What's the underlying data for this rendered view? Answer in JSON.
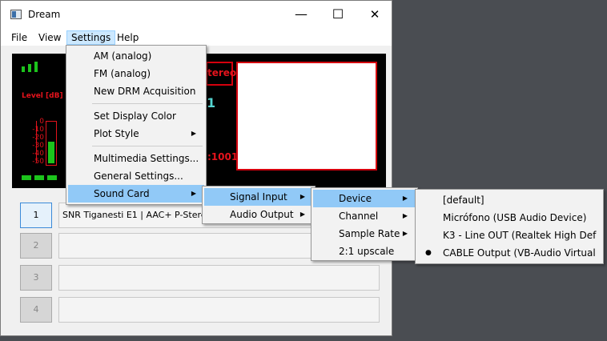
{
  "window": {
    "title": "Dream",
    "minimize": "—",
    "maximize": "☐",
    "close": "✕"
  },
  "menubar": {
    "file": "File",
    "view": "View",
    "settings": "Settings",
    "help": "Help"
  },
  "display": {
    "level_label": "Level [dB]",
    "scale": [
      "0",
      "-10",
      "-20",
      "-30",
      "-40",
      "-50"
    ],
    "stereo_text": "tereo",
    "digit": "1",
    "code_text": ":1001",
    "meter_level": 0.55
  },
  "channels": [
    {
      "number": "1",
      "label": "SNR Tiganesti E1   |   AAC+ P-Stereo"
    },
    {
      "number": "2",
      "label": ""
    },
    {
      "number": "3",
      "label": ""
    },
    {
      "number": "4",
      "label": ""
    }
  ],
  "settings_menu": {
    "items": [
      "AM (analog)",
      "FM (analog)",
      "New DRM Acquisition",
      "Set Display Color",
      "Plot Style",
      "Multimedia Settings...",
      "General Settings...",
      "Sound Card"
    ]
  },
  "soundcard_menu": {
    "items": [
      "Signal Input",
      "Audio Output"
    ]
  },
  "signal_input_menu": {
    "items": [
      "Device",
      "Channel",
      "Sample Rate",
      "2:1 upscale"
    ]
  },
  "device_menu": {
    "items": [
      "[default]",
      "Micrófono (USB Audio Device)",
      "K3 - Line OUT (Realtek High Def",
      "CABLE Output (VB-Audio Virtual"
    ],
    "selected_index": 3,
    "bullet": "●"
  }
}
